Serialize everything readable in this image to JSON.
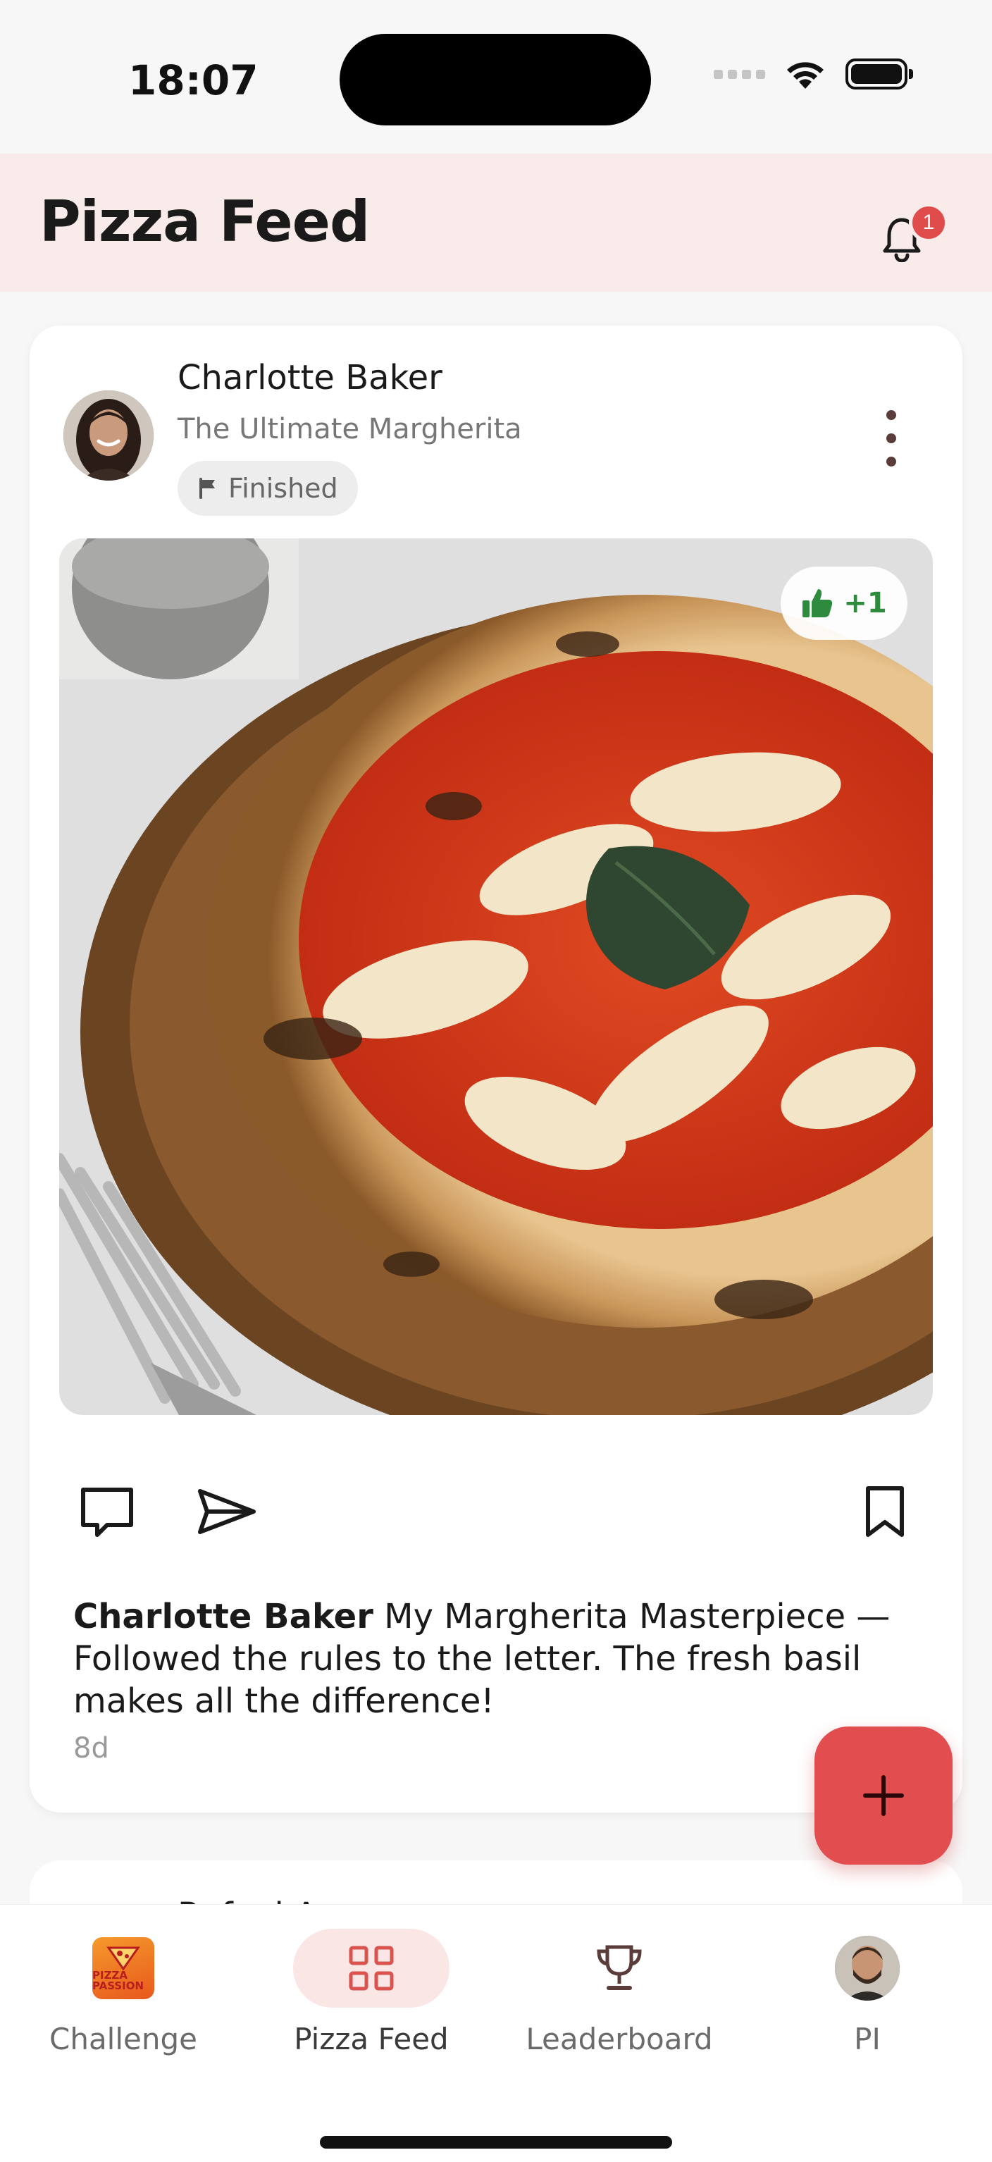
{
  "status_bar": {
    "time": "18:07"
  },
  "header": {
    "title": "Pizza Feed",
    "notification_count": "1"
  },
  "post": {
    "author": "Charlotte Baker",
    "recipe": "The Ultimate Margherita",
    "status": "Finished",
    "likes": "+1",
    "caption_author": "Charlotte Baker",
    "caption_text": "My Margherita Masterpiece — Followed the rules to the letter. The fresh basil makes all the difference!",
    "age": "8d"
  },
  "next_post": {
    "peek_text": "Rafael A"
  },
  "nav": {
    "items": [
      {
        "label": "Challenge",
        "icon": "pizza-passion-logo",
        "active": false
      },
      {
        "label": "Pizza Feed",
        "icon": "grid-icon",
        "active": true
      },
      {
        "label": "Leaderboard",
        "icon": "trophy-icon",
        "active": false
      },
      {
        "label": "PI",
        "icon": "profile-avatar",
        "active": false
      }
    ]
  },
  "branding": {
    "challenge_logo_text": "PIZZA PASSION"
  },
  "colors": {
    "accent": "#e24d4f",
    "header_bg": "#f9ebea",
    "like_green": "#2e8b3e"
  }
}
